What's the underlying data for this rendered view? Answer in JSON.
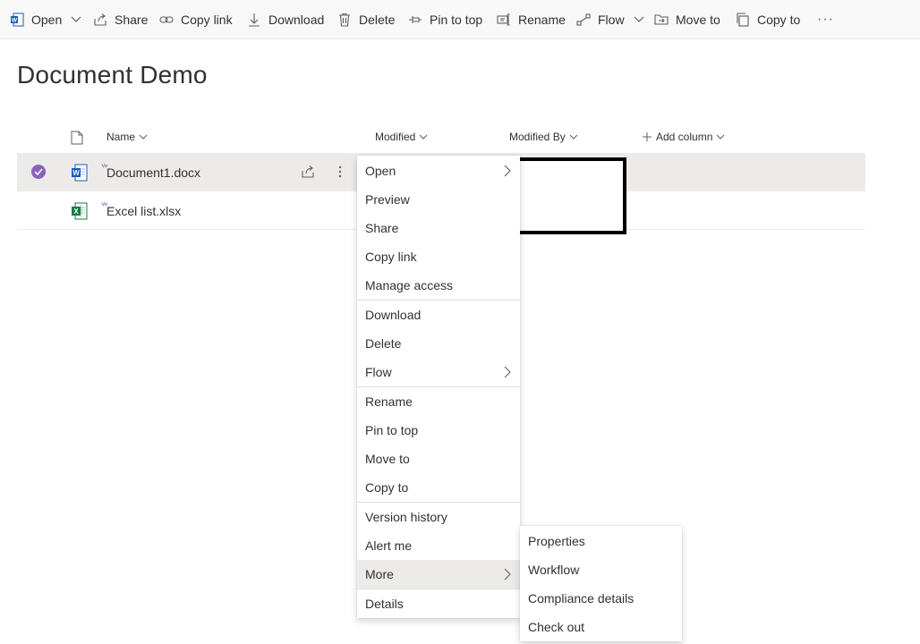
{
  "toolbar": {
    "open": "Open",
    "share": "Share",
    "copy_link": "Copy link",
    "download": "Download",
    "delete": "Delete",
    "pin_to_top": "Pin to top",
    "rename": "Rename",
    "flow": "Flow",
    "move_to": "Move to",
    "copy_to": "Copy to",
    "more": "···"
  },
  "page": {
    "title": "Document Demo"
  },
  "columns": {
    "name": "Name",
    "modified": "Modified",
    "modified_by": "Modified By",
    "add_column": "Add column"
  },
  "files": [
    {
      "name": "Document1.docx",
      "type": "word",
      "selected": true
    },
    {
      "name": "Excel list.xlsx",
      "type": "excel",
      "selected": false
    }
  ],
  "context_menu": {
    "items": [
      "Open",
      "Preview",
      "Share",
      "Copy link",
      "Manage access",
      "Download",
      "Delete",
      "Flow",
      "Rename",
      "Pin to top",
      "Move to",
      "Copy to",
      "Version history",
      "Alert me",
      "More",
      "Details"
    ]
  },
  "more_submenu": {
    "items": [
      "Properties",
      "Workflow",
      "Compliance details",
      "Check out"
    ]
  },
  "colors": {
    "accent": "#8764b8",
    "word": "#185abd",
    "excel": "#107c41",
    "highlight": "#edebe9"
  }
}
